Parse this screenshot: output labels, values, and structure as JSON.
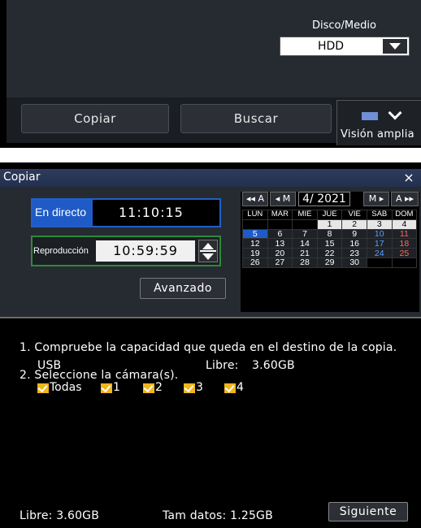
{
  "top": {
    "disk_label": "Disco/Medio",
    "disk_value": "HDD",
    "copy_button": "Copiar",
    "search_button": "Buscar",
    "wide_view_button": "Visión amplia"
  },
  "dialog": {
    "title": "Copiar",
    "close": "×",
    "live": {
      "label": "En directo",
      "time": "11:10:15"
    },
    "playback": {
      "label": "Reproducción",
      "time": "10:59:59"
    },
    "advanced_button": "Avanzado",
    "calendar": {
      "nav": {
        "prev_year": "◂◂ A",
        "prev_month": "◂ M",
        "next_month": "M ▸",
        "next_year": "A ▸▸"
      },
      "month_label": "4/ 2021",
      "weekdays": [
        "LUN",
        "MAR",
        "MIE",
        "JUE",
        "VIE",
        "SAB",
        "DOM"
      ],
      "weeks": [
        [
          "",
          "",
          "",
          "1",
          "2",
          "3",
          "4"
        ],
        [
          "5",
          "6",
          "7",
          "8",
          "9",
          "10",
          "11"
        ],
        [
          "12",
          "13",
          "14",
          "15",
          "16",
          "17",
          "18"
        ],
        [
          "19",
          "20",
          "21",
          "22",
          "23",
          "24",
          "25"
        ],
        [
          "26",
          "27",
          "28",
          "29",
          "30",
          "",
          ""
        ]
      ],
      "selected_day": "5"
    },
    "step1": "1. Compruebe la capacidad que queda en el destino de la copia.",
    "destination": "USB",
    "free_label": "Libre:",
    "free_value": "3.60GB",
    "step2": "2. Seleccione la cámara(s).",
    "cameras": [
      {
        "label": "Todas",
        "checked": true
      },
      {
        "label": "1",
        "checked": true
      },
      {
        "label": "2",
        "checked": true
      },
      {
        "label": "3",
        "checked": true
      },
      {
        "label": "4",
        "checked": true
      }
    ],
    "footer_free": "Libre:  3.60GB",
    "footer_size": "Tam datos: 1.25GB",
    "next_button": "Siguiente"
  },
  "colors": {
    "accent_blue": "#1f5bc6",
    "green_frame": "#2d8a3c",
    "checkbox": "#f2b51c",
    "saturday": "#5aa0ff",
    "sunday": "#ff6b5b"
  }
}
